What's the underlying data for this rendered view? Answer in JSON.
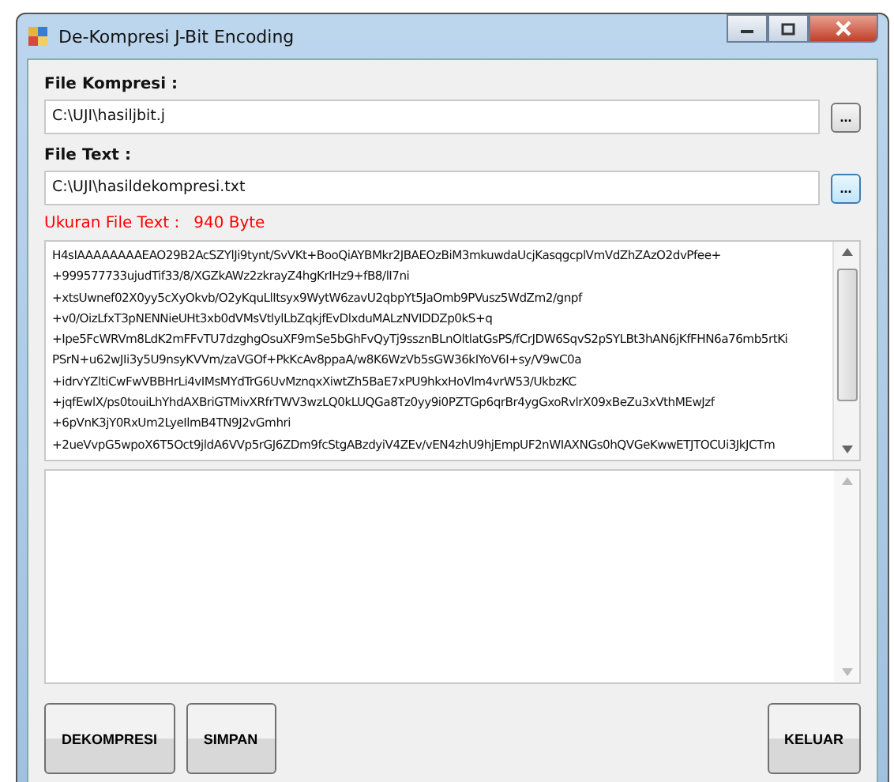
{
  "window": {
    "title": "De-Kompresi J-Bit Encoding"
  },
  "fields": [
    {
      "label": "File Kompresi :",
      "value": "C:\\UJI\\hasiljbit.j",
      "browse": {
        "label": "...",
        "focused": false
      }
    },
    {
      "label": "File Text :",
      "value": "C:\\UJI\\hasildekompresi.txt",
      "browse": {
        "label": "...",
        "focused": true
      }
    }
  ],
  "size_info": {
    "label": "Ukuran File Text :",
    "value": "940 Byte"
  },
  "content_lines": [
    "H4sIAAAAAAAAEAO29B2AcSZYlJi9tynt/SvVKt+BooQiAYBMkr2JBAEOzBiM3mkuwdaUcjKasqgcplVmVdZhZAzO2dvPfee+",
    "+999577733ujudTif33/8/XGZkAWz2zkrayZ4hgKrIHz9+fB8/lI7ni",
    "+xtsUwnef02X0yy5cXyOkvb/O2yKquLlItsyx9WytW6zavU2qbpYt5JaOmb9PVusz5WdZm2/gnpf",
    "+v0/OizLfxT3pNENNieUHt3xb0dVMsVtlylLbZqkjfEvDlxduMALzNVIDDZp0kS+q",
    "+Ipe5FcWRVm8LdK2mFFvTU7dzghgOsuXF9mSe5bGhFvQyTj9ssznBLnOltlatGsPS/fCrJDW6SqvS2pSYLBt3hAN6jKfFHN6a76mb5rtKi",
    "PSrN+u62wJIi3y5U9nsyKVVm/zaVGOf+PkKcAv8ppaA/w8K6WzVb5sGW36kIYoV6I+sy/V9wC0a",
    "+idrvYZltiCwFwVBBHrLi4vIMsMYdTrG6UvMznqxXiwtZh5BaE7xPU9hkxHoVlm4vrW53/UkbzKC",
    "+jqfEwlX/ps0touiLhYhdAXBriGTMivXRfrTWV3wzLQ0kLUQGa8Tz0yy9i0PZTGp6qrBr4ygGxoRvlrX09xBeZu3xVthMEwJzf",
    "+6pVnK3jY0RxUm2LyeIlmB4TN9J2vGmhri",
    "+2ueVvpG5wpoX6T5Oct9jldA6VVp5rGJ6ZDm9fcStgABzdyiV4ZEv/vEN4zhU9hjEmpUF2nWIAXNGs0hQVGeKwwETJTOCUi3JkJCTm"
  ],
  "buttons": [
    {
      "label": "DEKOMPRESI",
      "kind": "action"
    },
    {
      "label": "SIMPAN",
      "kind": "action"
    },
    {
      "label": "KELUAR",
      "kind": "exit"
    }
  ]
}
